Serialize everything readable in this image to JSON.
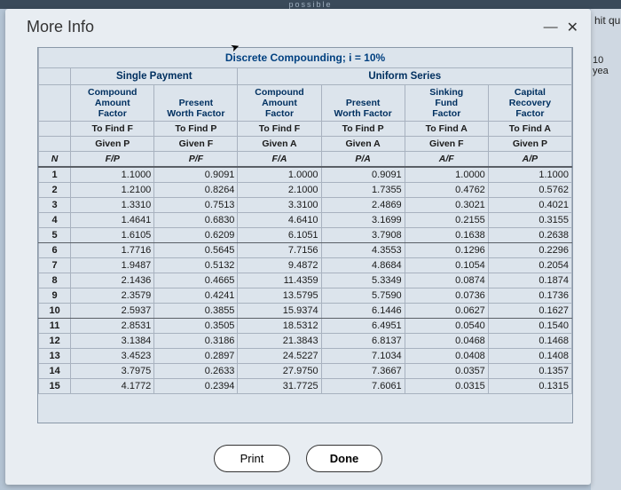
{
  "topbar": "possible",
  "right": {
    "t1": "hit qu",
    "t2": "10 yea"
  },
  "dialog": {
    "title": "More Info",
    "minimize": "—",
    "close": "✕",
    "print": "Print",
    "done": "Done"
  },
  "table": {
    "title": "Discrete Compounding; i = 10%",
    "group1": "Single Payment",
    "group2": "Uniform Series",
    "cols": [
      {
        "h1": "Compound",
        "h2": "Amount",
        "h3": "Factor",
        "s1": "To Find F",
        "s2": "Given P",
        "s3": "F/P"
      },
      {
        "h1": "",
        "h2": "Present",
        "h3": "Worth Factor",
        "s1": "To Find P",
        "s2": "Given F",
        "s3": "P/F"
      },
      {
        "h1": "Compound",
        "h2": "Amount",
        "h3": "Factor",
        "s1": "To Find F",
        "s2": "Given A",
        "s3": "F/A"
      },
      {
        "h1": "",
        "h2": "Present",
        "h3": "Worth Factor",
        "s1": "To Find P",
        "s2": "Given A",
        "s3": "P/A"
      },
      {
        "h1": "Sinking",
        "h2": "Fund",
        "h3": "Factor",
        "s1": "To Find A",
        "s2": "Given F",
        "s3": "A/F"
      },
      {
        "h1": "Capital",
        "h2": "Recovery",
        "h3": "Factor",
        "s1": "To Find A",
        "s2": "Given P",
        "s3": "A/P"
      }
    ],
    "nlabel": "N",
    "rows": [
      {
        "n": "1",
        "v": [
          "1.1000",
          "0.9091",
          "1.0000",
          "0.9091",
          "1.0000",
          "1.1000"
        ]
      },
      {
        "n": "2",
        "v": [
          "1.2100",
          "0.8264",
          "2.1000",
          "1.7355",
          "0.4762",
          "0.5762"
        ]
      },
      {
        "n": "3",
        "v": [
          "1.3310",
          "0.7513",
          "3.3100",
          "2.4869",
          "0.3021",
          "0.4021"
        ]
      },
      {
        "n": "4",
        "v": [
          "1.4641",
          "0.6830",
          "4.6410",
          "3.1699",
          "0.2155",
          "0.3155"
        ]
      },
      {
        "n": "5",
        "v": [
          "1.6105",
          "0.6209",
          "6.1051",
          "3.7908",
          "0.1638",
          "0.2638"
        ],
        "sep": true
      },
      {
        "n": "6",
        "v": [
          "1.7716",
          "0.5645",
          "7.7156",
          "4.3553",
          "0.1296",
          "0.2296"
        ]
      },
      {
        "n": "7",
        "v": [
          "1.9487",
          "0.5132",
          "9.4872",
          "4.8684",
          "0.1054",
          "0.2054"
        ]
      },
      {
        "n": "8",
        "v": [
          "2.1436",
          "0.4665",
          "11.4359",
          "5.3349",
          "0.0874",
          "0.1874"
        ]
      },
      {
        "n": "9",
        "v": [
          "2.3579",
          "0.4241",
          "13.5795",
          "5.7590",
          "0.0736",
          "0.1736"
        ]
      },
      {
        "n": "10",
        "v": [
          "2.5937",
          "0.3855",
          "15.9374",
          "6.1446",
          "0.0627",
          "0.1627"
        ],
        "sep": true
      },
      {
        "n": "11",
        "v": [
          "2.8531",
          "0.3505",
          "18.5312",
          "6.4951",
          "0.0540",
          "0.1540"
        ]
      },
      {
        "n": "12",
        "v": [
          "3.1384",
          "0.3186",
          "21.3843",
          "6.8137",
          "0.0468",
          "0.1468"
        ]
      },
      {
        "n": "13",
        "v": [
          "3.4523",
          "0.2897",
          "24.5227",
          "7.1034",
          "0.0408",
          "0.1408"
        ]
      },
      {
        "n": "14",
        "v": [
          "3.7975",
          "0.2633",
          "27.9750",
          "7.3667",
          "0.0357",
          "0.1357"
        ]
      },
      {
        "n": "15",
        "v": [
          "4.1772",
          "0.2394",
          "31.7725",
          "7.6061",
          "0.0315",
          "0.1315"
        ]
      }
    ]
  }
}
